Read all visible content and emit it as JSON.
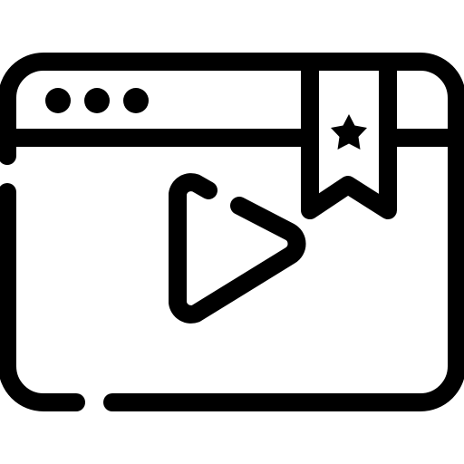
{
  "icon": {
    "name": "bookmarked-video-browser-icon",
    "stroke_color": "#000000",
    "background_color": "#ffffff",
    "parts": [
      "browser-window-frame",
      "window-control-dots",
      "bookmark-ribbon",
      "star-icon",
      "play-icon"
    ]
  }
}
